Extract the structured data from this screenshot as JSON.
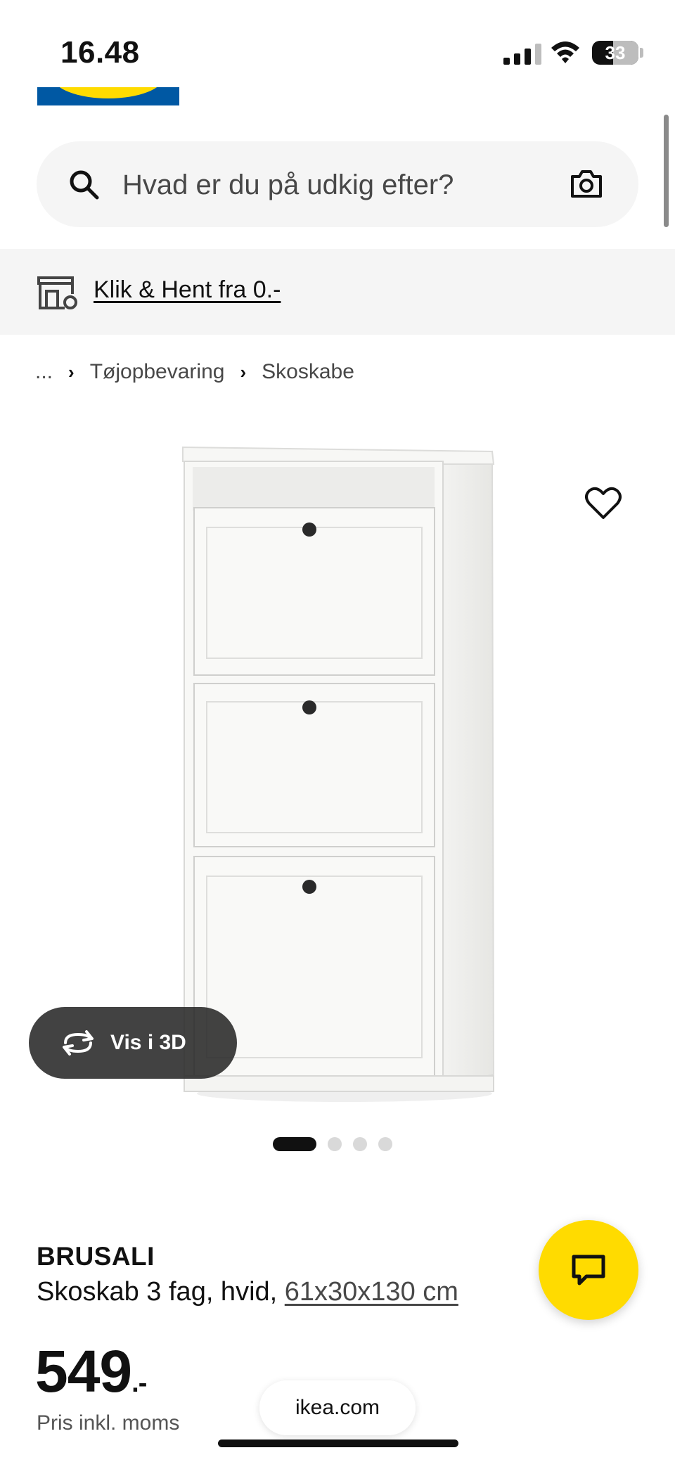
{
  "status_bar": {
    "time": "16.48",
    "battery": "33"
  },
  "search": {
    "placeholder": "Hvad er du på udkig efter?"
  },
  "banner": {
    "text": "Klik & Hent fra 0.-"
  },
  "breadcrumb": {
    "items": [
      "...",
      "Tøjopbevaring",
      "Skoskabe"
    ]
  },
  "gallery": {
    "view_3d_label": "Vis i 3D",
    "pagination": {
      "current": 1,
      "total": 4
    }
  },
  "product": {
    "name": "BRUSALI",
    "description": "Skoskab 3 fag, hvid, ",
    "dimensions": "61x30x130 cm",
    "price": "549",
    "price_suffix": ".-",
    "price_info": "Pris inkl. moms"
  },
  "browser": {
    "url": "ikea.com"
  },
  "colors": {
    "brand_blue": "#0058a3",
    "brand_yellow": "#ffdb00"
  },
  "icons": [
    "search-icon",
    "camera-icon",
    "store-pickup-icon",
    "chevron-right-icon",
    "heart-icon",
    "rotate-3d-icon",
    "chat-icon"
  ]
}
